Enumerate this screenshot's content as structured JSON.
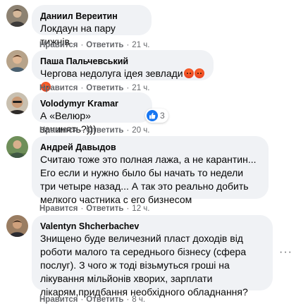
{
  "comments": [
    {
      "author": "Даниил Вереитин",
      "text": "Локдаун на пару тижнів",
      "like": "Нравится",
      "reply": "Ответить",
      "time": "21 ч."
    },
    {
      "author": "Паша Пальчевський",
      "text": "Чергова недолуга ідея зевлади",
      "like": "Нравится",
      "reply": "Ответить",
      "time": "21 ч."
    },
    {
      "author": "Volodymyr Kramar",
      "text": "А «Велюр» зачинять?)))",
      "like": "Нравится",
      "reply": "Ответить",
      "time": "20 ч.",
      "reaction_count": "3"
    },
    {
      "author": "Андрей Давыдов",
      "text": "Считаю тоже это полная лажа, а не карантин... Его если и нужно было бы начать то недели три четыре назад... А так это реально добить мелкого частника с его бизнесом",
      "like": "Нравится",
      "reply": "Ответить",
      "time": "12 ч."
    },
    {
      "author": "Valentyn Shcherbachev",
      "text": "Знищено буде величезний пласт доходів від роботи малого та середнього бізнесу (сфера послуг). З чого ж тоді візьмуться гроші на лікування мільйонів хворих, зарплати лікарям,придбання необхідного обладнання?",
      "like": "Нравится",
      "reply": "Ответить",
      "time": "8 ч."
    }
  ],
  "separator": "·",
  "colors": {
    "bubble": "#f0f2f5",
    "meta": "#65676b",
    "like_blue": "#1877f2"
  }
}
